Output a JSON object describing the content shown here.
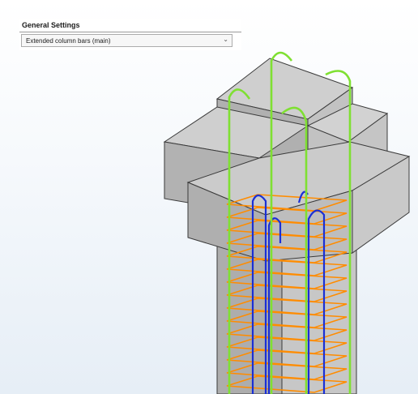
{
  "general_settings": {
    "title": "General Settings",
    "dropdown_value": "Extended column bars (main)"
  },
  "colors": {
    "concrete": "#b7b7b7",
    "concrete_edge": "#3a3a3a",
    "main_bars_green": "#7fe032",
    "extended_bars_blue": "#1a2fd6",
    "stirrups_orange": "#ff8c00"
  },
  "icons": {
    "dropdown": "chevron-down-icon"
  }
}
